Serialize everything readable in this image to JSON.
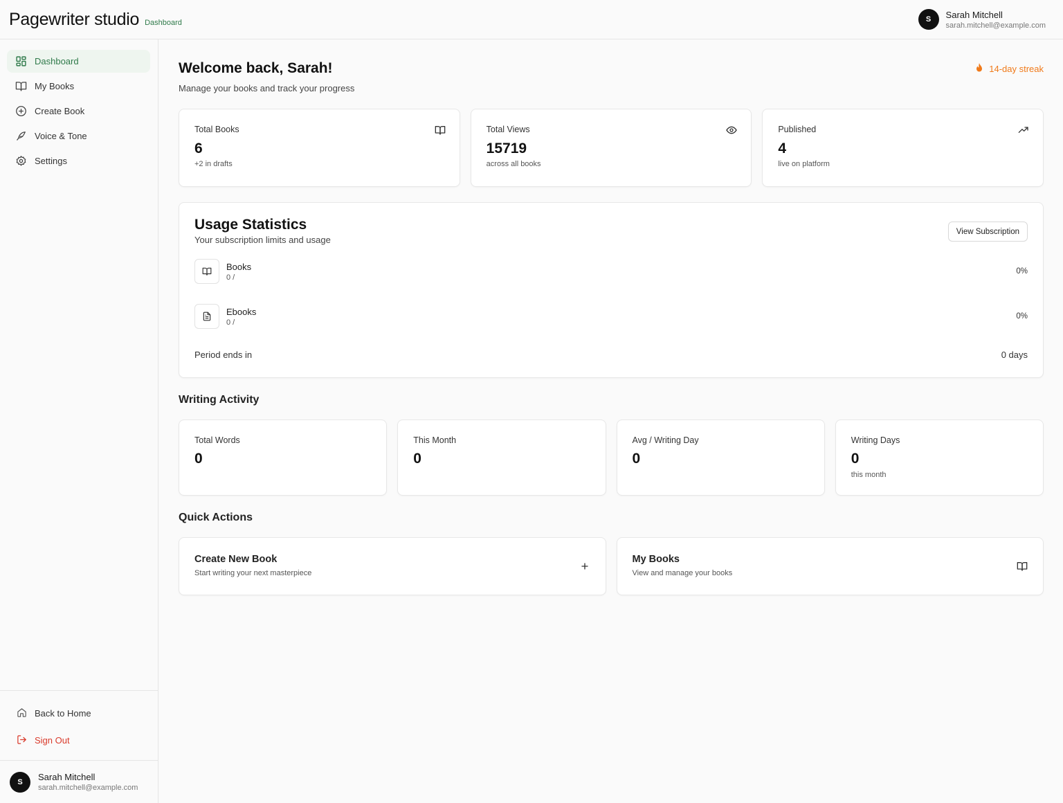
{
  "header": {
    "brand": "Pagewriter studio",
    "section": "Dashboard",
    "user": {
      "initial": "S",
      "name": "Sarah Mitchell",
      "email": "sarah.mitchell@example.com"
    }
  },
  "sidebar": {
    "items": [
      {
        "label": "Dashboard",
        "icon": "dashboard-grid-icon",
        "active": true
      },
      {
        "label": "My Books",
        "icon": "book-open-icon"
      },
      {
        "label": "Create Book",
        "icon": "plus-circle-icon"
      },
      {
        "label": "Voice & Tone",
        "icon": "feather-pen-icon"
      },
      {
        "label": "Settings",
        "icon": "gear-icon"
      }
    ],
    "bottom": {
      "home_label": "Back to Home",
      "signout_label": "Sign Out"
    },
    "user": {
      "initial": "S",
      "name": "Sarah Mitchell",
      "email": "sarah.mitchell@example.com"
    }
  },
  "main": {
    "welcome_title": "Welcome back, Sarah!",
    "welcome_sub": "Manage your books and track your progress",
    "streak": "14-day streak",
    "stats": [
      {
        "label": "Total Books",
        "value": "6",
        "sub": "+2 in drafts",
        "icon": "book-open-icon"
      },
      {
        "label": "Total Views",
        "value": "15719",
        "sub": "across all books",
        "icon": "eye-icon"
      },
      {
        "label": "Published",
        "value": "4",
        "sub": "live on platform",
        "icon": "trending-up-icon"
      }
    ],
    "usage": {
      "title": "Usage Statistics",
      "subtitle": "Your subscription limits and usage",
      "button": "View Subscription",
      "lines": [
        {
          "name": "Books",
          "count": "0 /",
          "percent": "0%",
          "icon": "book-open-icon"
        },
        {
          "name": "Ebooks",
          "count": "0 /",
          "percent": "0%",
          "icon": "document-icon"
        }
      ],
      "period_label": "Period ends in",
      "period_value": "0 days"
    },
    "activity": {
      "title": "Writing Activity",
      "cards": [
        {
          "label": "Total Words",
          "value": "0",
          "sub": ""
        },
        {
          "label": "This Month",
          "value": "0",
          "sub": ""
        },
        {
          "label": "Avg / Writing Day",
          "value": "0",
          "sub": ""
        },
        {
          "label": "Writing Days",
          "value": "0",
          "sub": "this month"
        }
      ]
    },
    "quick_actions": {
      "title": "Quick Actions",
      "cards": [
        {
          "title": "Create New Book",
          "sub": "Start writing your next masterpiece",
          "icon": "plus-icon"
        },
        {
          "title": "My Books",
          "sub": "View and manage your books",
          "icon": "book-open-icon"
        }
      ]
    }
  },
  "colors": {
    "accent_green": "#2f7a4a",
    "active_bg": "#eef5ef",
    "streak_orange": "#f07a1a",
    "signout_red": "#d93a2b"
  }
}
